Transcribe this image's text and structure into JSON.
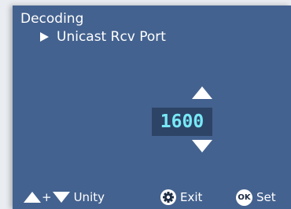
{
  "menu": {
    "title": "Decoding",
    "item": "Unicast Rcv Port"
  },
  "value": {
    "current": "1600"
  },
  "footer": {
    "plus": "+",
    "unity_label": "Unity",
    "exit_label": "Exit",
    "ok_badge": "OK",
    "set_label": "Set"
  },
  "colors": {
    "panel_bg": "#44628f",
    "value_box_bg": "#2d4466",
    "value_text": "#78e8f6",
    "page_bg": "#e9ecf1"
  },
  "icons": {
    "submenu_marker": "triangle-right-icon",
    "increment": "up-arrow-icon",
    "decrement": "down-arrow-icon",
    "exit": "gear-icon",
    "set": "ok-icon"
  }
}
